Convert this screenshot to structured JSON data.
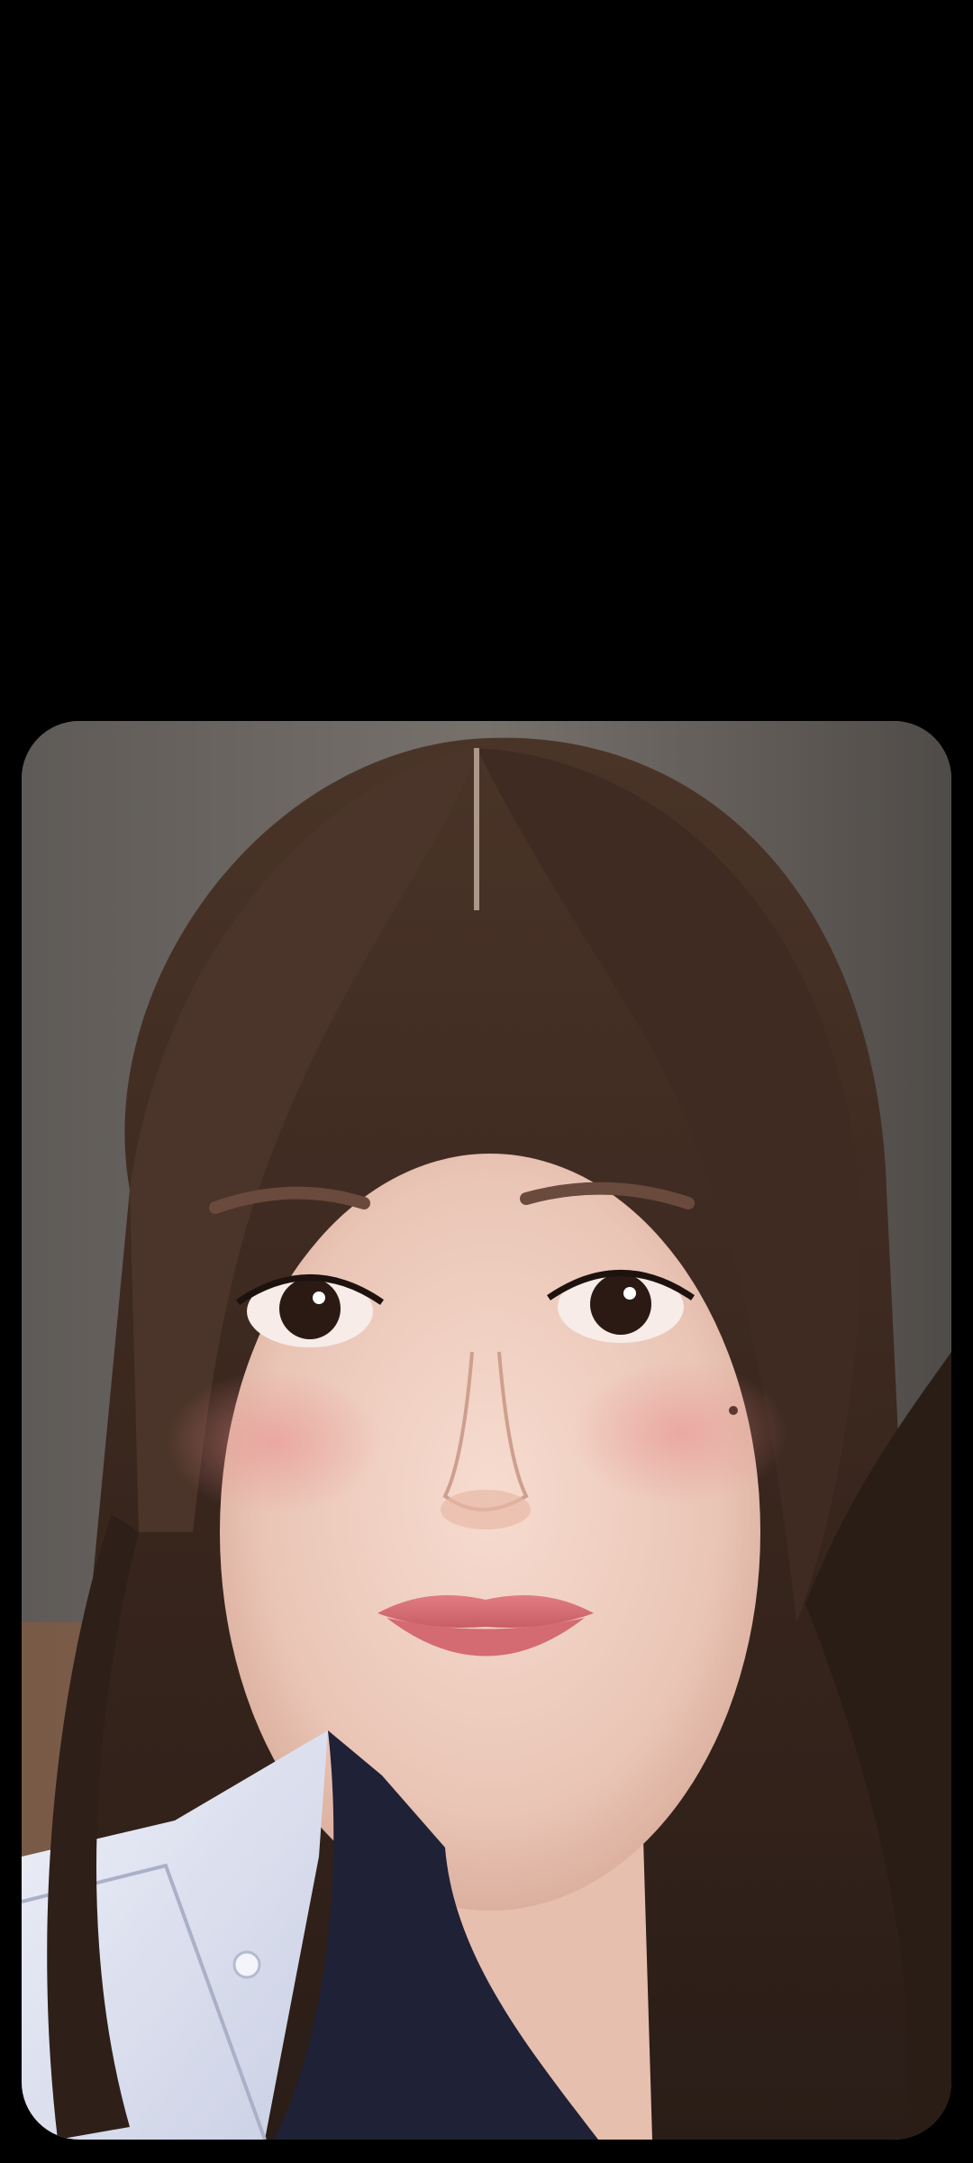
{
  "viewer": {
    "background_color": "#000000",
    "photo": {
      "subject": "portrait-photo"
    }
  }
}
